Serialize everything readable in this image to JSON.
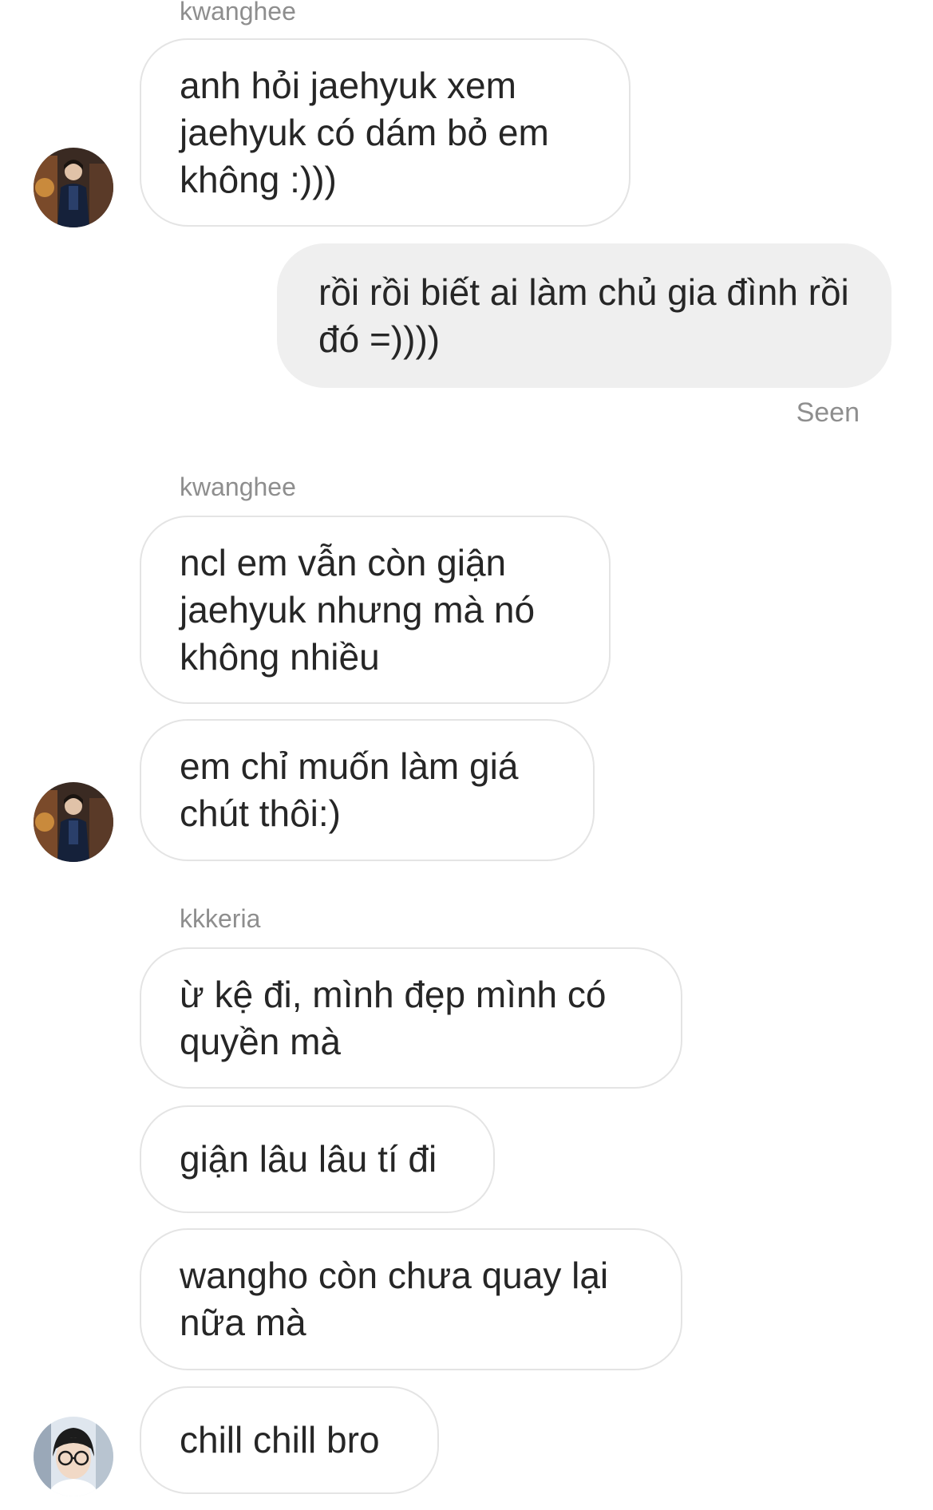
{
  "conversation": {
    "messages": [
      {
        "sender": "kwanghee",
        "text": "anh hỏi jaehyuk xem jaehyuk có dám bỏ em không :)))"
      },
      {
        "sender": "me",
        "text": "rồi rồi biết ai làm chủ gia đình rồi đó =))))"
      },
      {
        "sender": "kwanghee",
        "text": "ncl em vẫn còn giận jaehyuk nhưng mà nó không nhiều"
      },
      {
        "sender": "kwanghee",
        "text": "em chỉ muốn làm giá chút thôi:)"
      },
      {
        "sender": "kkkeria",
        "text": "ừ kệ đi, mình đẹp mình có quyền mà"
      },
      {
        "sender": "kkkeria",
        "text": "giận lâu lâu tí đi"
      },
      {
        "sender": "kkkeria",
        "text": "wangho còn chưa quay lại nữa mà"
      },
      {
        "sender": "kkkeria",
        "text": "chill chill bro"
      }
    ],
    "sender_labels": [
      "kwanghee",
      "kwanghee",
      "kkkeria"
    ],
    "status": "Seen"
  },
  "avatars": {
    "kwanghee": {
      "icon": "profile-photo-icon",
      "bg": "#3a2a22",
      "accent": "#c98a3c"
    },
    "kkkeria": {
      "icon": "profile-photo-icon",
      "bg": "#dfe6ee",
      "accent": "#1c1c1c"
    }
  },
  "colors": {
    "received_bubble_bg": "#ffffff",
    "received_bubble_border": "#e4e4e4",
    "sent_bubble_bg": "#efefef",
    "label_gray": "#8e8e8e",
    "text": "#262626"
  }
}
